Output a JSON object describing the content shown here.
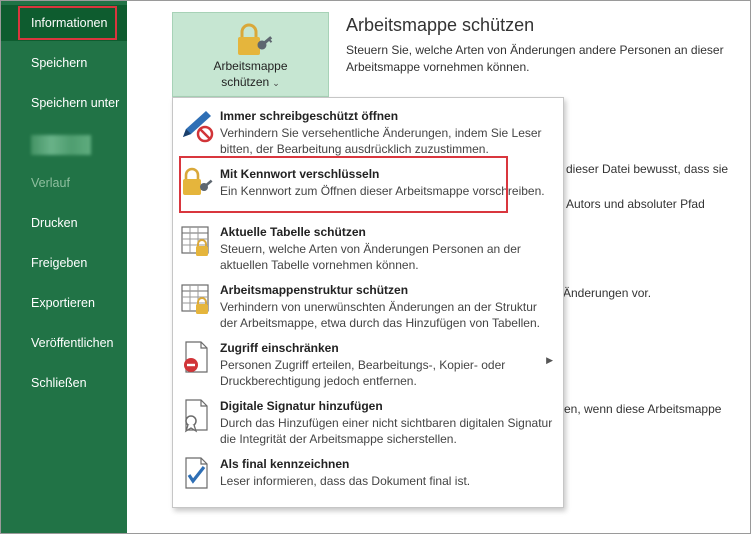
{
  "sidebar": {
    "items": [
      {
        "label": "Informationen",
        "active": true
      },
      {
        "label": "Speichern"
      },
      {
        "label": "Speichern unter"
      },
      {
        "label": ""
      },
      {
        "label": "Verlauf",
        "disabled": true
      },
      {
        "label": "Drucken"
      },
      {
        "label": "Freigeben"
      },
      {
        "label": "Exportieren"
      },
      {
        "label": "Veröffentlichen"
      },
      {
        "label": "Schließen"
      }
    ]
  },
  "protect": {
    "button_line1": "Arbeitsmappe",
    "button_line2": "schützen",
    "title": "Arbeitsmappe schützen",
    "description": "Steuern Sie, welche Arten von Änderungen andere Personen an dieser Arbeitsmappe vornehmen können."
  },
  "background_text": [
    "dieser Datei bewusst, dass sie",
    "Autors und absoluter Pfad",
    "Änderungen vor.",
    "en, wenn diese Arbeitsmappe"
  ],
  "menu": {
    "items": [
      {
        "title": "Immer schreibgeschützt öffnen",
        "description": "Verhindern Sie versehentliche Änderungen, indem Sie Leser bitten, der Bearbeitung ausdrücklich zuzustimmen.",
        "icon": "pen-forbidden-icon"
      },
      {
        "title": "Mit Kennwort verschlüsseln",
        "description": "Ein Kennwort zum Öffnen dieser Arbeitsmappe vorschreiben.",
        "icon": "lock-key-icon",
        "highlighted": true
      },
      {
        "title": "Aktuelle Tabelle schützen",
        "description": "Steuern, welche Arten von Änderungen Personen an der aktuellen Tabelle vornehmen können.",
        "icon": "sheet-lock-icon"
      },
      {
        "title": "Arbeitsmappenstruktur schützen",
        "description": "Verhindern von unerwünschten Änderungen an der Struktur der Arbeitsmappe, etwa durch das Hinzufügen von Tabellen.",
        "icon": "workbook-structure-lock-icon"
      },
      {
        "title": "Zugriff einschränken",
        "description": "Personen Zugriff erteilen, Bearbeitungs-, Kopier- oder Druckberechtigung jedoch entfernen.",
        "icon": "document-restrict-icon",
        "submenu": true
      },
      {
        "title": "Digitale Signatur hinzufügen",
        "description": "Durch das Hinzufügen einer nicht sichtbaren digitalen Signatur die Integrität der Arbeitsmappe sicherstellen.",
        "icon": "document-signature-icon"
      },
      {
        "title": "Als final kennzeichnen",
        "description": "Leser informieren, dass das Dokument final ist.",
        "icon": "document-checkmark-icon"
      }
    ]
  },
  "colors": {
    "sidebar_bg": "#217346",
    "sidebar_active": "#0e5c2f",
    "button_bg": "#c6e6d2",
    "highlight_red": "#d9363e",
    "lock_gold": "#e5b53c"
  }
}
